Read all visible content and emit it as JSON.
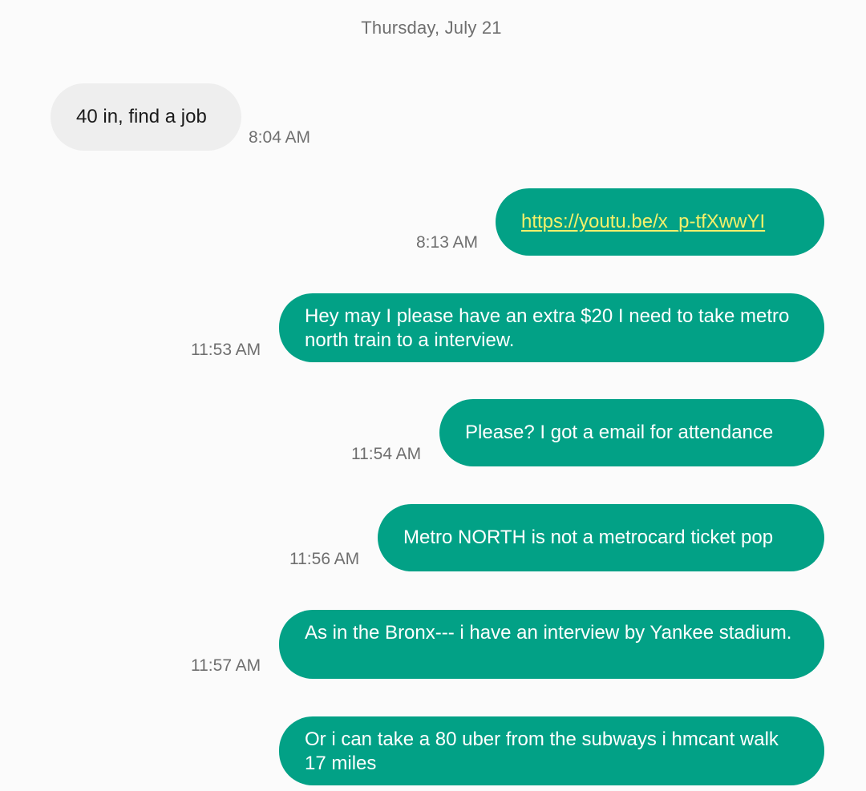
{
  "date_header": "Thursday, July 21",
  "messages": [
    {
      "direction": "incoming",
      "text": "40 in, find a job",
      "time": "8:04 AM"
    },
    {
      "direction": "outgoing",
      "text": "https://youtu.be/x_p-tfXwwYI",
      "time": "8:13 AM",
      "is_link": true
    },
    {
      "direction": "outgoing",
      "text": "Hey may I please have an extra $20 I need to take metro north train to a interview.",
      "time": "11:53 AM"
    },
    {
      "direction": "outgoing",
      "text": "Please? I got a email for attendance",
      "time": "11:54 AM"
    },
    {
      "direction": "outgoing",
      "text": "Metro NORTH is not a metrocard ticket pop",
      "time": "11:56 AM"
    },
    {
      "direction": "outgoing",
      "text": "As in the Bronx--- i have an interview by Yankee stadium.",
      "time": "11:57 AM"
    },
    {
      "direction": "outgoing",
      "text": "Or i can take a 80 uber from the subways i hmcant walk 17 miles",
      "time": ""
    }
  ],
  "colors": {
    "outgoing_bubble": "#02a186",
    "incoming_bubble": "#eeeeee",
    "link": "#f4f06a",
    "timestamp": "#6f6f6f",
    "background": "#fbfbfb"
  }
}
